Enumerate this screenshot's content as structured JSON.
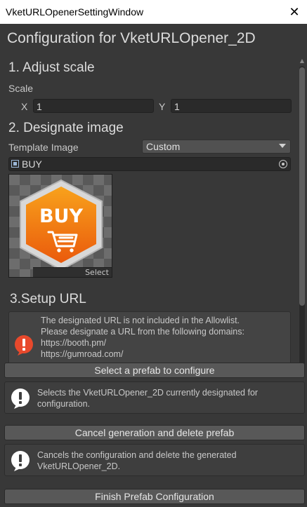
{
  "window": {
    "title": "VketURLOpenerSettingWindow",
    "close_glyph": "✕"
  },
  "heading": "Configuration for VketURLOpener_2D",
  "scale_section": {
    "title": "1. Adjust scale",
    "scale_label": "Scale",
    "x_label": "X",
    "x_value": "1",
    "y_label": "Y",
    "y_value": "1"
  },
  "image_section": {
    "title": "2. Designate image",
    "template_label": "Template Image",
    "template_value": "Custom",
    "object_value": "BUY",
    "preview_text": "BUY",
    "select_label": "Select"
  },
  "url_section": {
    "title": "3.Setup URL",
    "warning_lines": [
      "The designated URL is not included in the Allowlist.",
      "Please designate a URL from the following domains:",
      "https://booth.pm/",
      "https://gumroad.com/"
    ]
  },
  "actions": {
    "select_prefab": "Select a prefab to configure",
    "select_prefab_info": [
      "Selects the VketURLOpener_2D currently designated for",
      "configuration."
    ],
    "cancel": "Cancel generation and delete prefab",
    "cancel_info": [
      "Cancels the configuration and delete the generated",
      "VketURLOpener_2D."
    ],
    "finish": "Finish Prefab Configuration"
  },
  "colors": {
    "background": "#383838",
    "button": "#585858",
    "warning": "#e8492c",
    "badge_orange": "#f07a10"
  }
}
